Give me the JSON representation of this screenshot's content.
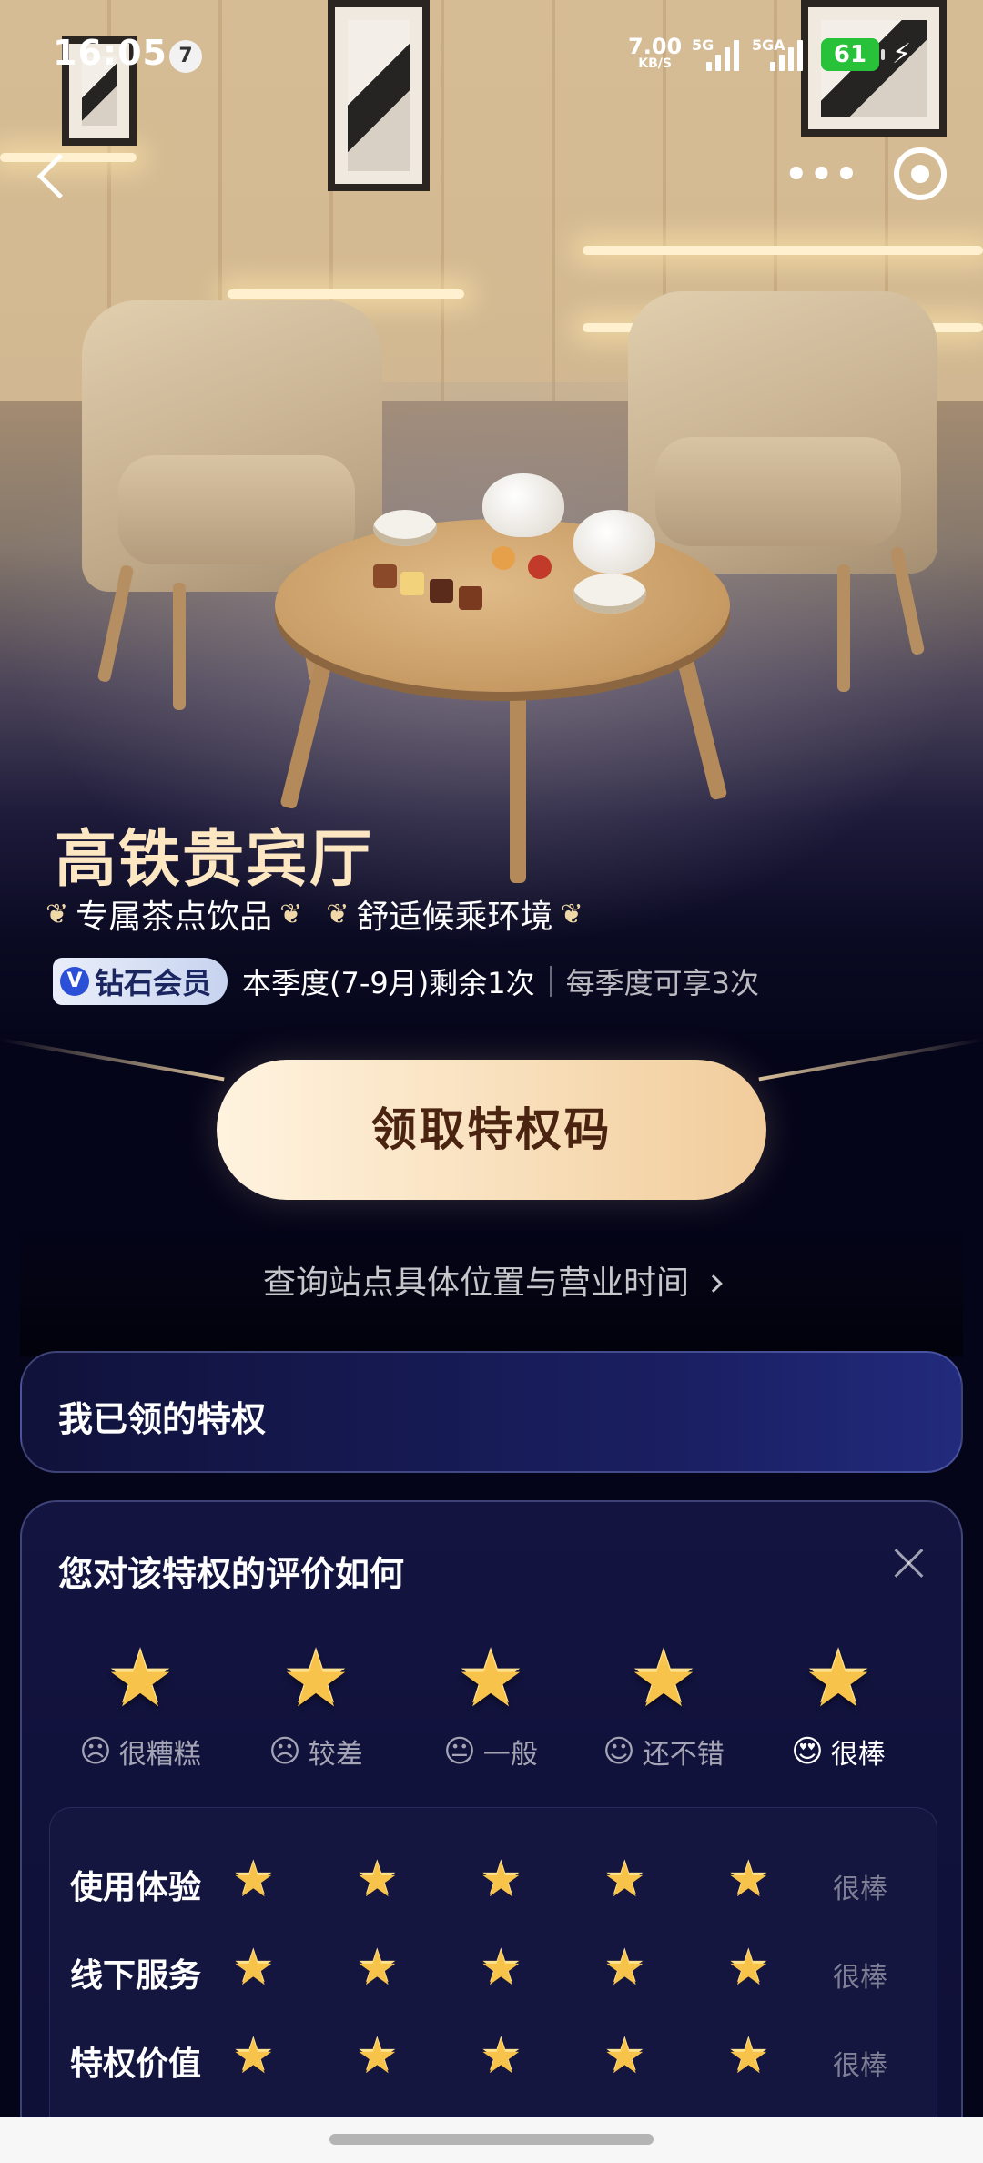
{
  "status_bar": {
    "time": "16:05",
    "notification_count": "7",
    "net_speed": "7.00",
    "net_speed_unit": "KB/S",
    "signal_1_label": "5G",
    "signal_2_label": "5GA",
    "battery": "61"
  },
  "hero": {
    "title": "高铁贵宾厅",
    "features": [
      "专属茶点饮品",
      "舒适候乘环境"
    ],
    "member_badge": "钻石会员",
    "quota_remaining": "本季度(7-9月)剩余1次",
    "quota_total": "每季度可享3次"
  },
  "actions": {
    "claim_button": "领取特权码",
    "query_link": "查询站点具体位置与营业时间"
  },
  "my_privileges": {
    "title": "我已领的特权"
  },
  "rating": {
    "title": "您对该特权的评价如何",
    "options": [
      {
        "label": "很糟糕",
        "face": "☹",
        "selected": false
      },
      {
        "label": "较差",
        "face": "☹",
        "selected": false
      },
      {
        "label": "一般",
        "face": "😐",
        "selected": false
      },
      {
        "label": "还不错",
        "face": "☺",
        "selected": false
      },
      {
        "label": "很棒",
        "face": "😍",
        "selected": true
      }
    ],
    "selected_stars": 5,
    "sub_ratings": [
      {
        "label": "使用体验",
        "stars": 5,
        "value": "很棒"
      },
      {
        "label": "线下服务",
        "stars": 5,
        "value": "很棒"
      },
      {
        "label": "特权价值",
        "stars": 5,
        "value": "很棒"
      }
    ]
  },
  "colors": {
    "background": "#05051a",
    "title_gold": "#fde7c2",
    "star": "#f8c34a",
    "button_start": "#fff3df",
    "button_end": "#f1cc9b",
    "battery": "#27c23a"
  }
}
